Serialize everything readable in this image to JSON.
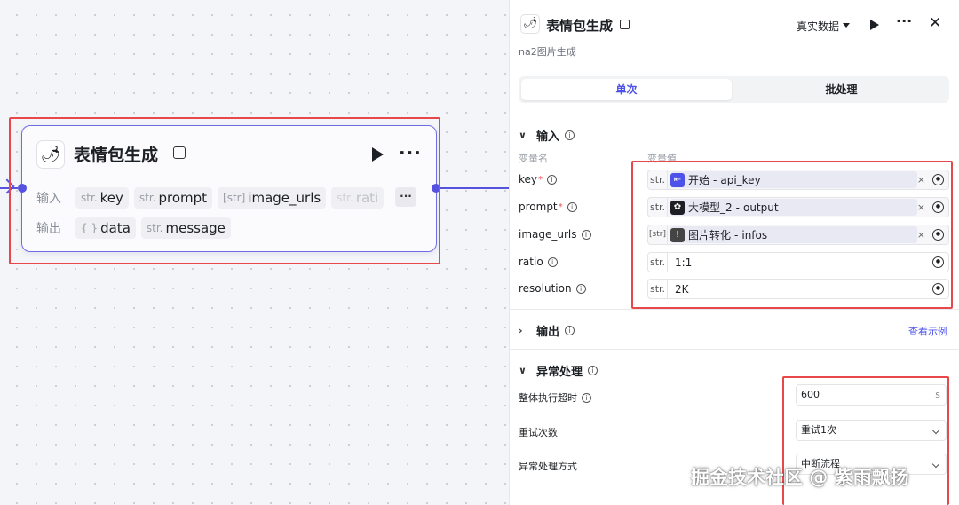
{
  "canvas": {
    "node": {
      "title": "表情包生成",
      "input_label": "输入",
      "output_label": "输出",
      "inputs": [
        {
          "type": "str.",
          "name": "key"
        },
        {
          "type": "str.",
          "name": "prompt"
        },
        {
          "type": "[str]",
          "name": "image_urls"
        },
        {
          "type": "str.",
          "name": "rati"
        }
      ],
      "more_chip": "···",
      "outputs": [
        {
          "type": "{ }",
          "name": "data"
        },
        {
          "type": "str.",
          "name": "message"
        }
      ],
      "more": "···"
    }
  },
  "panel": {
    "title": "表情包生成",
    "mode": "真实数据",
    "more": "···",
    "close": "✕",
    "subtitle": "na2图片生成",
    "tabs": [
      {
        "label": "单次",
        "active": true
      },
      {
        "label": "批处理",
        "active": false
      }
    ],
    "inputs_section": {
      "title": "输入",
      "col_name": "变量名",
      "col_value": "变量值",
      "rows": [
        {
          "name": "key",
          "required": true,
          "type": "str.",
          "ref_node": "开始",
          "ref_var": "api_key",
          "sep": "-",
          "clear": "×"
        },
        {
          "name": "prompt",
          "required": true,
          "type": "str.",
          "ref_node": "大模型_2",
          "ref_var": "output",
          "sep": "-",
          "clear": "×"
        },
        {
          "name": "image_urls",
          "required": false,
          "type": "[str]",
          "ref_node": "图片转化",
          "ref_var": "infos",
          "sep": "-",
          "clear": "×"
        },
        {
          "name": "ratio",
          "required": false,
          "type": "str.",
          "value": "1:1"
        },
        {
          "name": "resolution",
          "required": false,
          "type": "str.",
          "value": "2K"
        }
      ]
    },
    "outputs_section": {
      "title": "输出",
      "link": "查看示例"
    },
    "error_section": {
      "title": "异常处理",
      "timeout_label": "整体执行超时",
      "timeout_value": "600",
      "timeout_unit": "s",
      "retry_label": "重试次数",
      "retry_value": "重试1次",
      "mode_label": "异常处理方式",
      "mode_value": "中断流程"
    }
  },
  "watermark": "掘金技术社区 @ 紫雨飘扬",
  "colors": {
    "accent": "#4d53e8",
    "edge": "#5552e0",
    "highlight": "#e9484a"
  }
}
